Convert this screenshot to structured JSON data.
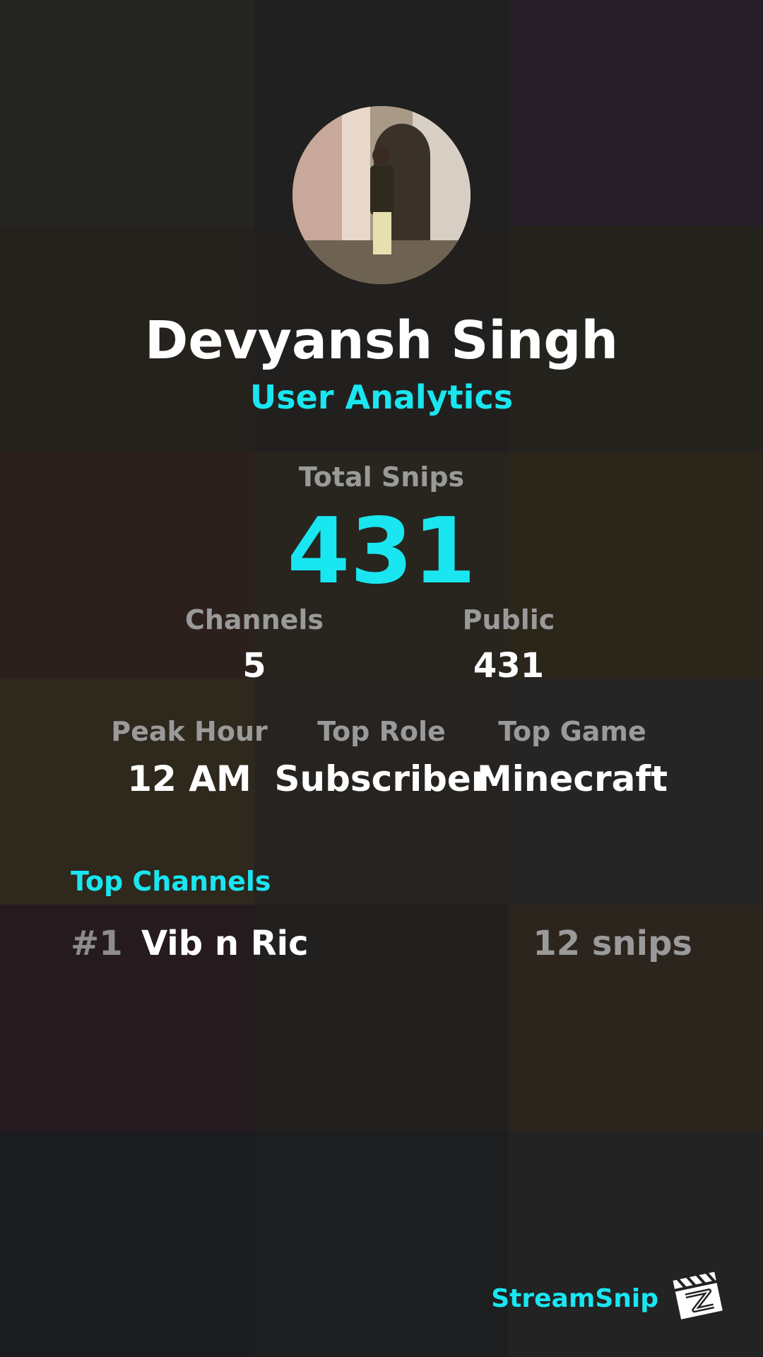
{
  "colors": {
    "accent": "#19e6f0",
    "muted": "#9a9a9a",
    "text": "#ffffff"
  },
  "profile": {
    "name": "Devyansh Singh",
    "subtitle": "User Analytics"
  },
  "stats": {
    "total_snips_label": "Total Snips",
    "total_snips_value": "431",
    "channels_label": "Channels",
    "channels_value": "5",
    "public_label": "Public",
    "public_value": "431",
    "peak_hour_label": "Peak Hour",
    "peak_hour_value": "12 AM",
    "top_role_label": "Top Role",
    "top_role_value": "Subscriber",
    "top_game_label": "Top Game",
    "top_game_value": "Minecraft"
  },
  "top_channels": {
    "title": "Top Channels",
    "items": [
      {
        "rank": "#1",
        "name": "Vib n Ric",
        "snips": "12 snips"
      }
    ]
  },
  "brand": {
    "name": "StreamSnip",
    "logo_icon": "clapperboard-icon"
  }
}
